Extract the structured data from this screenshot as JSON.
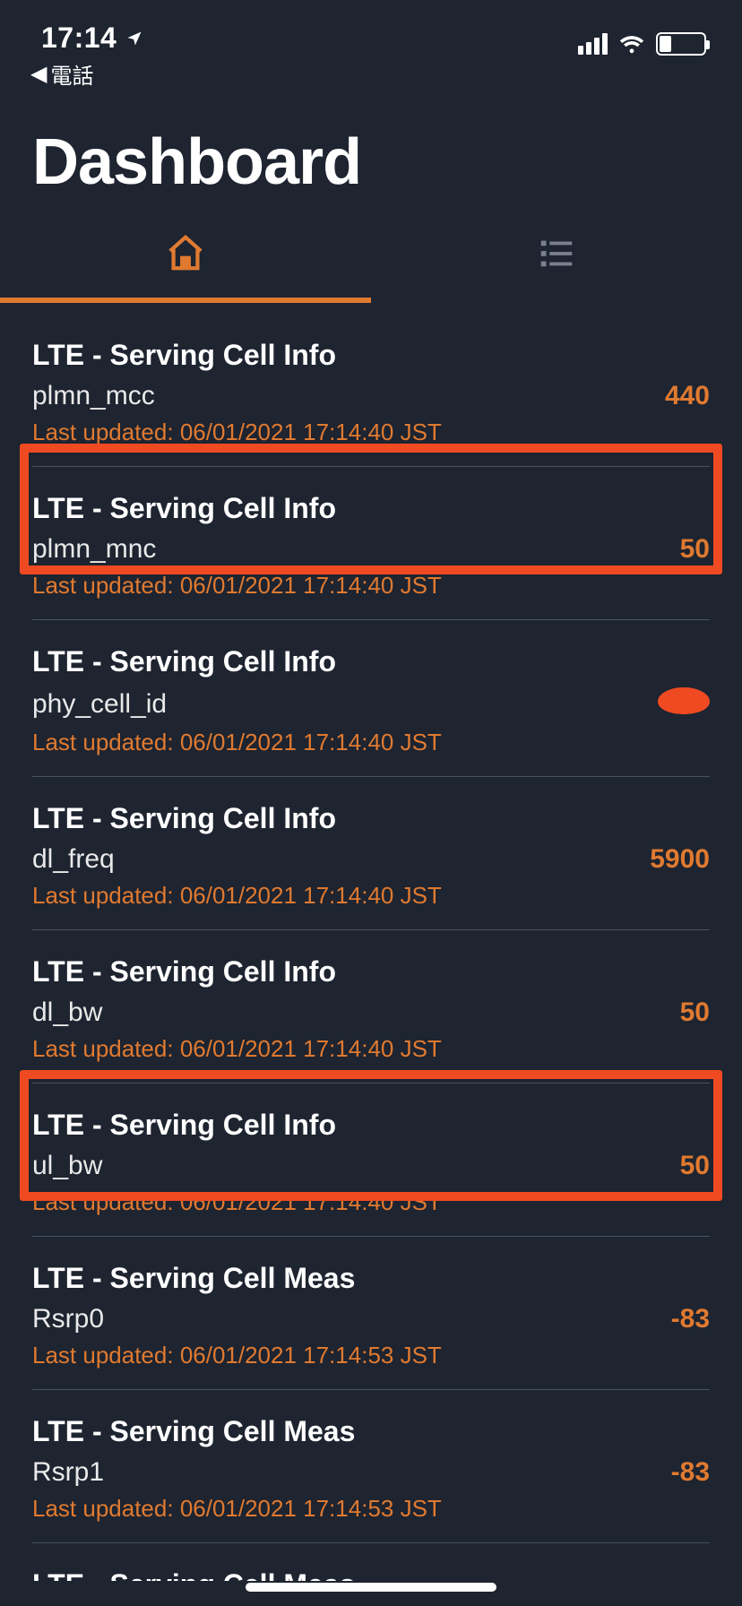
{
  "statusbar": {
    "time": "17:14",
    "back_app_label": "電話"
  },
  "header": {
    "title": "Dashboard"
  },
  "last_updated_prefix": "Last updated: ",
  "items": [
    {
      "title": "LTE - Serving Cell Info",
      "param": "plmn_mcc",
      "value": "440",
      "updated": "06/01/2021 17:14:40 JST",
      "redacted": false
    },
    {
      "title": "LTE - Serving Cell Info",
      "param": "plmn_mnc",
      "value": "50",
      "updated": "06/01/2021 17:14:40 JST",
      "redacted": false
    },
    {
      "title": "LTE - Serving Cell Info",
      "param": "phy_cell_id",
      "value": "",
      "updated": "06/01/2021 17:14:40 JST",
      "redacted": true
    },
    {
      "title": "LTE - Serving Cell Info",
      "param": "dl_freq",
      "value": "5900",
      "updated": "06/01/2021 17:14:40 JST",
      "redacted": false
    },
    {
      "title": "LTE - Serving Cell Info",
      "param": "dl_bw",
      "value": "50",
      "updated": "06/01/2021 17:14:40 JST",
      "redacted": false
    },
    {
      "title": "LTE - Serving Cell Info",
      "param": "ul_bw",
      "value": "50",
      "updated": "06/01/2021 17:14:40 JST",
      "redacted": false
    },
    {
      "title": "LTE - Serving Cell Meas",
      "param": "Rsrp0",
      "value": "-83",
      "updated": "06/01/2021 17:14:53 JST",
      "redacted": false
    },
    {
      "title": "LTE - Serving Cell Meas",
      "param": "Rsrp1",
      "value": "-83",
      "updated": "06/01/2021 17:14:53 JST",
      "redacted": false
    }
  ],
  "cutoff_item_title": "LTE - Serving Cell Meas"
}
